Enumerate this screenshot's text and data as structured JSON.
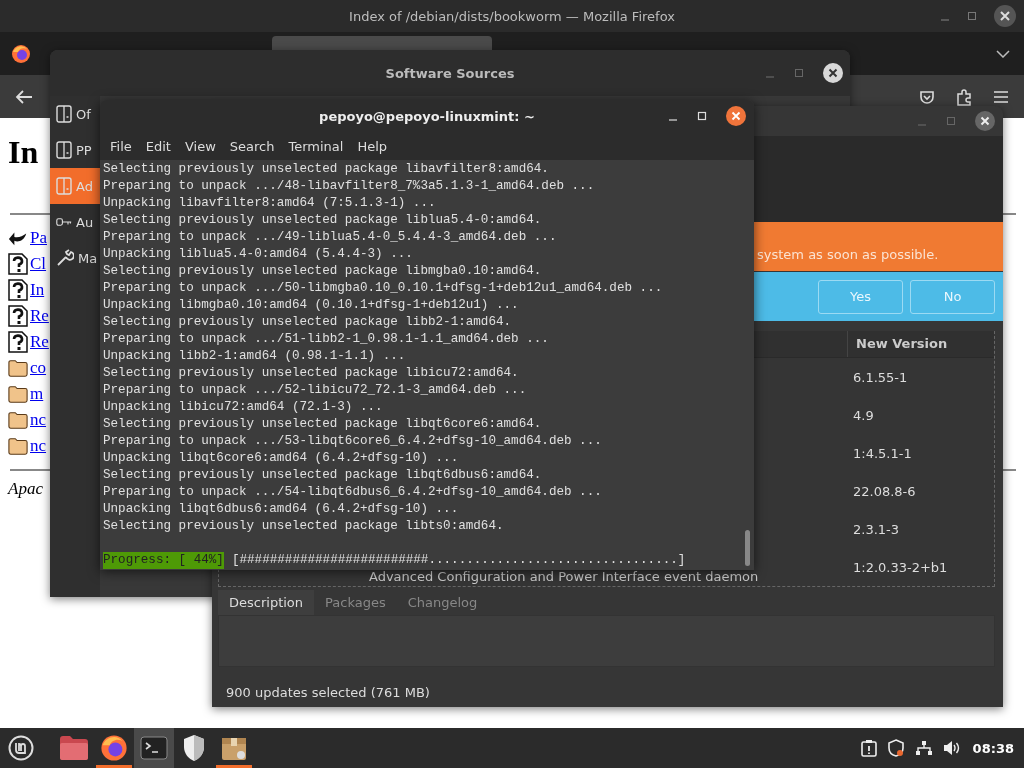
{
  "firefox": {
    "title": "Index of /debian/dists/bookworm — Mozilla Firefox",
    "content": {
      "heading": "In",
      "links": [
        {
          "kind": "back",
          "text": "Pa"
        },
        {
          "kind": "unknown",
          "text": "Cl"
        },
        {
          "kind": "unknown",
          "text": "In"
        },
        {
          "kind": "unknown",
          "text": "Re"
        },
        {
          "kind": "unknown",
          "text": "Re"
        },
        {
          "kind": "folder",
          "text": "co"
        },
        {
          "kind": "folder",
          "text": "m"
        },
        {
          "kind": "folder",
          "text": "nc"
        },
        {
          "kind": "folder",
          "text": "nc"
        }
      ],
      "footer": "Apac"
    }
  },
  "software_sources": {
    "title": "Software Sources",
    "sidebar": [
      {
        "kind": "book",
        "label": "Of",
        "selected": false
      },
      {
        "kind": "book",
        "label": "PP",
        "selected": false
      },
      {
        "kind": "book",
        "label": "Ad",
        "selected": true
      },
      {
        "kind": "key",
        "label": "Au",
        "selected": false
      },
      {
        "kind": "wrench",
        "label": "Ma",
        "selected": false
      }
    ]
  },
  "update_manager": {
    "banner": "system as soon as possible.",
    "buttons": [
      "Yes",
      "No"
    ],
    "table": {
      "columns": [
        "New Version"
      ],
      "rows": [
        {
          "new_version": "6.1.55-1"
        },
        {
          "new_version": "4.9"
        },
        {
          "new_version": "1:4.5.1-1"
        },
        {
          "new_version": "22.08.8-6"
        },
        {
          "new_version": "2.3.1-3"
        },
        {
          "new_version": "1:2.0.33-2+b1",
          "description": "Advanced Configuration and Power Interface event daemon"
        }
      ]
    },
    "tabs": [
      {
        "label": "Description",
        "selected": true
      },
      {
        "label": "Packages",
        "selected": false
      },
      {
        "label": "Changelog",
        "selected": false
      }
    ],
    "status": "900 updates selected (761 MB)"
  },
  "terminal": {
    "title": "pepoyo@pepoyo-linuxmint: ~",
    "menu": [
      "File",
      "Edit",
      "View",
      "Search",
      "Terminal",
      "Help"
    ],
    "lines": [
      "Selecting previously unselected package libavfilter8:amd64.",
      "Preparing to unpack .../48-libavfilter8_7%3a5.1.3-1_amd64.deb ...",
      "Unpacking libavfilter8:amd64 (7:5.1.3-1) ...",
      "Selecting previously unselected package liblua5.4-0:amd64.",
      "Preparing to unpack .../49-liblua5.4-0_5.4.4-3_amd64.deb ...",
      "Unpacking liblua5.4-0:amd64 (5.4.4-3) ...",
      "Selecting previously unselected package libmgba0.10:amd64.",
      "Preparing to unpack .../50-libmgba0.10_0.10.1+dfsg-1+deb12u1_amd64.deb ...",
      "Unpacking libmgba0.10:amd64 (0.10.1+dfsg-1+deb12u1) ...",
      "Selecting previously unselected package libb2-1:amd64.",
      "Preparing to unpack .../51-libb2-1_0.98.1-1.1_amd64.deb ...",
      "Unpacking libb2-1:amd64 (0.98.1-1.1) ...",
      "Selecting previously unselected package libicu72:amd64.",
      "Preparing to unpack .../52-libicu72_72.1-3_amd64.deb ...",
      "Unpacking libicu72:amd64 (72.1-3) ...",
      "Selecting previously unselected package libqt6core6:amd64.",
      "Preparing to unpack .../53-libqt6core6_6.4.2+dfsg-10_amd64.deb ...",
      "Unpacking libqt6core6:amd64 (6.4.2+dfsg-10) ...",
      "Selecting previously unselected package libqt6dbus6:amd64.",
      "Preparing to unpack .../54-libqt6dbus6_6.4.2+dfsg-10_amd64.deb ...",
      "Unpacking libqt6dbus6:amd64 (6.4.2+dfsg-10) ...",
      "Selecting previously unselected package libts0:amd64."
    ],
    "progress": {
      "label": "Progress: [ 44%]",
      "bar": "[#########################.................................]"
    }
  },
  "taskbar": {
    "apps": [
      {
        "kind": "files",
        "selected": false,
        "running": false
      },
      {
        "kind": "firefox",
        "selected": false,
        "running": true
      },
      {
        "kind": "terminal",
        "selected": true,
        "running": false
      },
      {
        "kind": "shield",
        "selected": false,
        "running": false
      },
      {
        "kind": "package",
        "selected": false,
        "running": true
      }
    ],
    "clock": "08:38"
  }
}
